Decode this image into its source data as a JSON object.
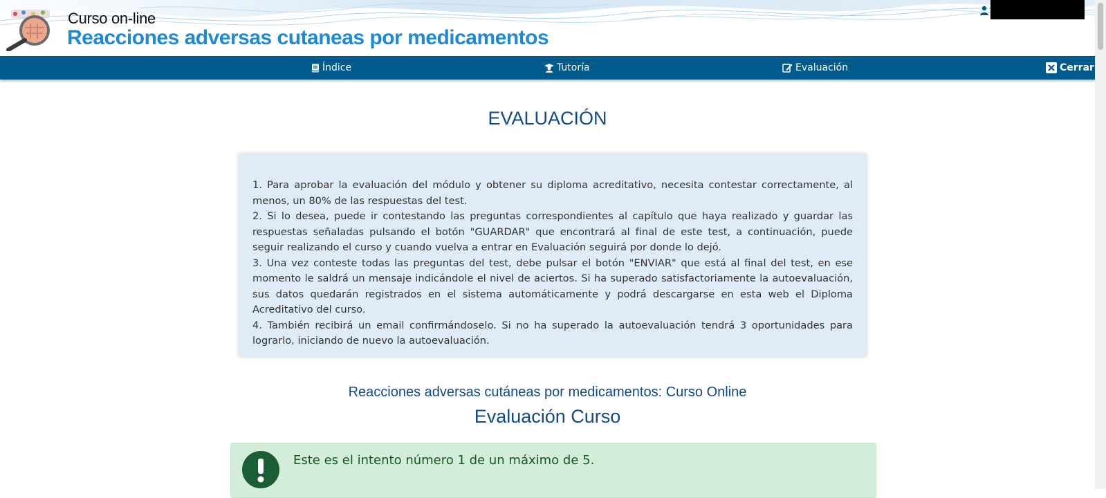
{
  "header": {
    "kicker": "Curso on-line",
    "title": "Reacciones adversas cutaneas por medicamentos",
    "logo_icon": "magnifier-skin-icon",
    "user_icon": "user-icon"
  },
  "nav": {
    "items": [
      {
        "label": "Índice",
        "icon": "book-icon"
      },
      {
        "label": "Tutoría",
        "icon": "teacher-icon"
      },
      {
        "label": "Evaluación",
        "icon": "edit-icon"
      }
    ],
    "close_label": "Cerrar",
    "close_icon": "close-icon"
  },
  "main": {
    "title": "EVALUACIÓN",
    "instructions": [
      "1. Para aprobar la evaluación del módulo y obtener su diploma acreditativo, necesita contestar correctamente, al menos, un 80% de las respuestas del test.",
      "2. Si lo desea, puede ir contestando las preguntas correspondientes al capítulo que haya realizado y guardar las respuestas señaladas pulsando el botón \"GUARDAR\" que encontrará al final de este test, a continuación, puede seguir realizando el curso y cuando vuelva a entrar en Evaluación seguirá por donde lo dejó.",
      "3. Una vez conteste todas las preguntas del test, debe pulsar el botón \"ENVIAR\" que está al final del test, en ese momento le saldrá un mensaje indicándole el nivel de aciertos. Si ha superado satisfactoriamente la autoevaluación, sus datos quedarán registrados en el sistema automáticamente y podrá descargarse en esta web el Diploma Acreditativo del curso.",
      "4. También recibirá un email confirmándoselo. Si no ha superado la autoevaluación tendrá 3 oportunidades para lograrlo, iniciando de nuevo la autoevaluación."
    ],
    "course_subtitle": "Reacciones adversas cutáneas por medicamentos: Curso Online",
    "eval_title": "Evaluación Curso",
    "alert": {
      "icon": "exclamation-circle-icon",
      "text": "Este es el intento número 1 de un máximo de 5."
    }
  },
  "colors": {
    "nav_bg": "#005a8c",
    "title_blue": "#0f4a8c",
    "course_title_blue": "#1e8ad6",
    "info_bg": "#dfebf7",
    "alert_bg": "#d4edda",
    "alert_icon": "#1b5e35"
  }
}
